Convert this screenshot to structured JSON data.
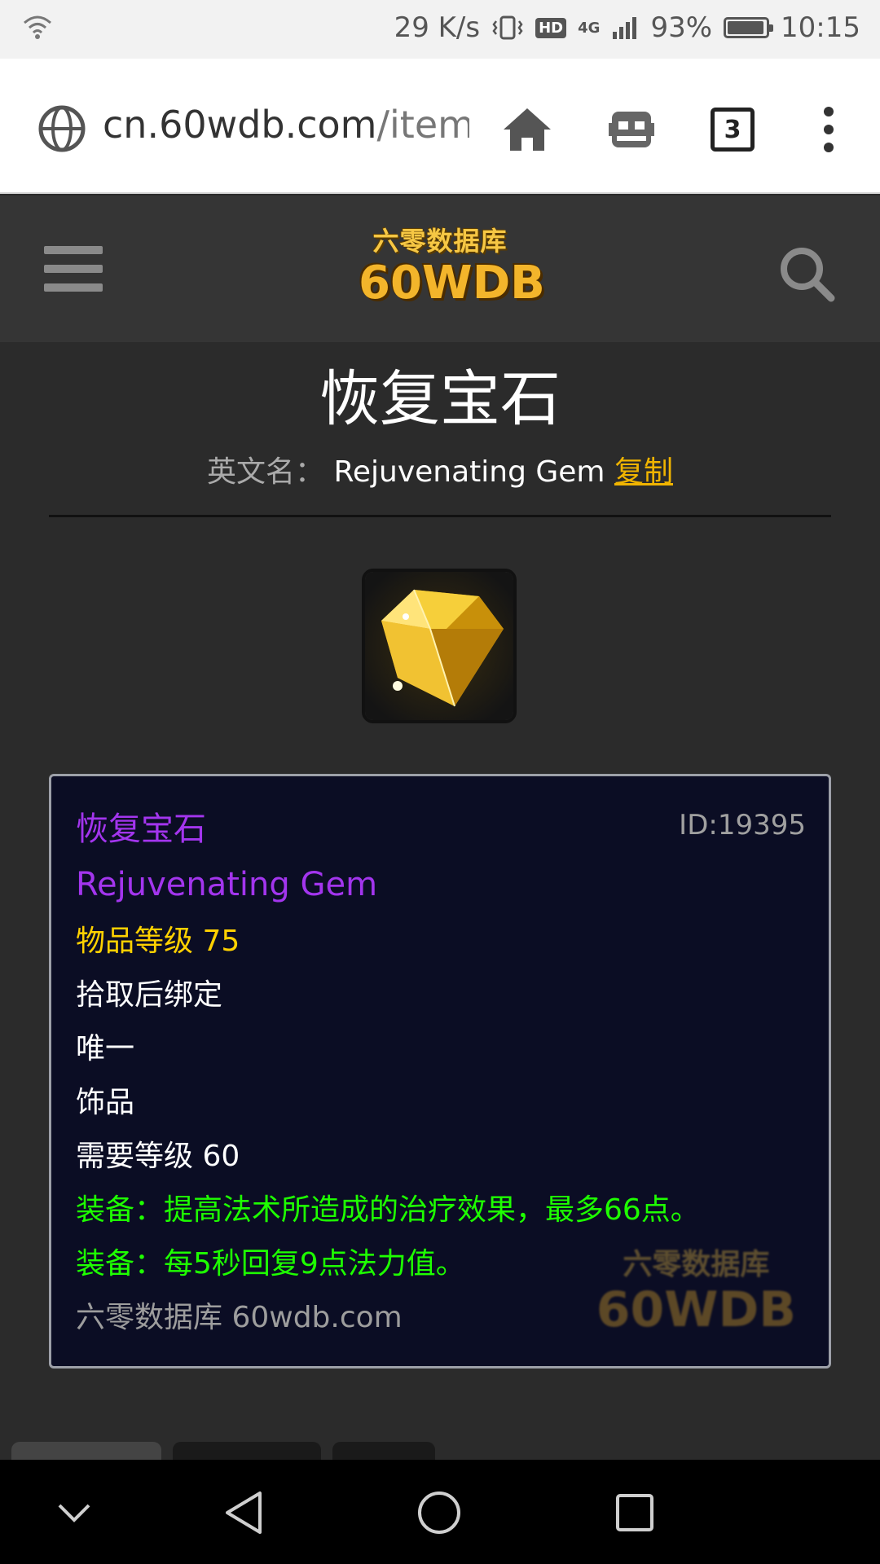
{
  "status_bar": {
    "speed": "29 K/s",
    "network_badge": "HD",
    "network_type": "4G",
    "battery": "93%",
    "time": "10:15"
  },
  "browser": {
    "url_host": "cn.60wdb.com",
    "url_path": "/item/",
    "tab_count": "3",
    "icons": [
      "globe-icon",
      "home-icon",
      "robot-icon",
      "tabs-icon",
      "more-icon"
    ]
  },
  "site_header": {
    "logo_cn": "六零数据库",
    "logo_en": "60WDB",
    "icons": [
      "menu-icon",
      "search-icon"
    ]
  },
  "item": {
    "title": "恢复宝石",
    "english_label": "英文名：",
    "english_name": "Rejuvenating Gem",
    "copy_label": "复制",
    "icon": "yellow-gem-icon"
  },
  "tooltip": {
    "name_cn": "恢复宝石",
    "id": "ID:19395",
    "name_en": "Rejuvenating Gem",
    "item_level": "物品等级 75",
    "binding": "拾取后绑定",
    "unique": "唯一",
    "slot": "饰品",
    "required_level": "需要等级 60",
    "effect_1": "装备：提高法术所造成的治疗效果，最多66点。",
    "effect_2": "装备：每5秒回复9点法力值。",
    "source": "六零数据库 60wdb.com",
    "watermark_cn": "六零数据库",
    "watermark_en": "60WDB",
    "colors": {
      "epic": "#a335ee",
      "item_level": "#ffd100",
      "equip": "#1eff00"
    }
  },
  "nav_bar": {
    "icons": [
      "collapse-icon",
      "back-icon",
      "home-circle-icon",
      "recents-icon"
    ]
  }
}
